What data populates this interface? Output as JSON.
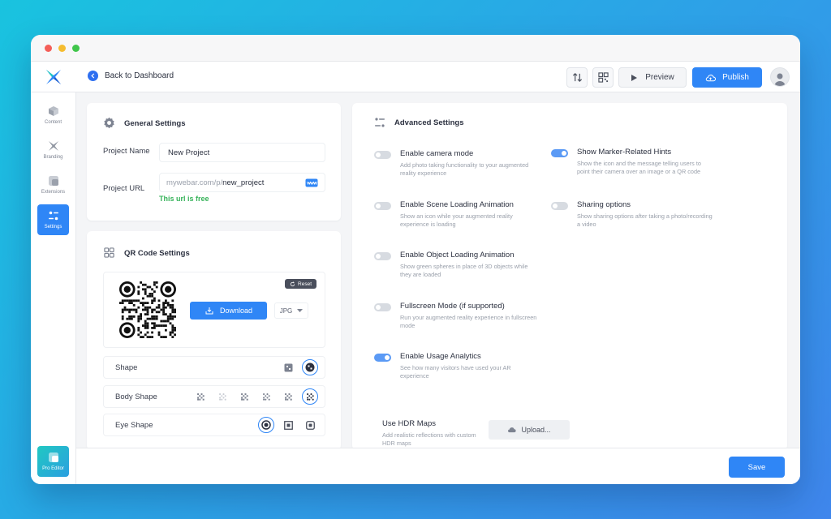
{
  "topbar": {
    "back_label": "Back to Dashboard",
    "preview_label": "Preview",
    "publish_label": "Publish"
  },
  "sidebar": {
    "items": [
      {
        "label": "Content",
        "icon": "cube-icon"
      },
      {
        "label": "Branding",
        "icon": "branding-icon"
      },
      {
        "label": "Extensions",
        "icon": "extensions-icon"
      },
      {
        "label": "Settings",
        "icon": "settings-icon",
        "active": true
      }
    ],
    "pro_editor_label": "Pro Editor"
  },
  "general": {
    "title": "General Settings",
    "project_name_label": "Project Name",
    "project_name_value": "New Project",
    "project_url_label": "Project URL",
    "url_prefix": "mywebar.com/p/",
    "url_slug": "new_project",
    "url_status": "This url is free"
  },
  "qr": {
    "title": "QR Code Settings",
    "reset_label": "Reset",
    "download_label": "Download",
    "format_value": "JPG",
    "shape_label": "Shape",
    "body_shape_label": "Body Shape",
    "eye_shape_label": "Eye Shape"
  },
  "advanced": {
    "title": "Advanced Settings",
    "settings": [
      {
        "title": "Enable camera mode",
        "desc": "Add photo taking functionality to your augmented reality experience",
        "on": false
      },
      {
        "title": "Enable Scene Loading Animation",
        "desc": "Show an icon while your augmented reality experience is loading",
        "on": false
      },
      {
        "title": "Enable Object Loading Animation",
        "desc": "Show green spheres in place of 3D objects while they are loaded",
        "on": false
      },
      {
        "title": "Fullscreen Mode (if supported)",
        "desc": "Run your augmented reality experience in fullscreen mode",
        "on": false
      },
      {
        "title": "Enable Usage Analytics",
        "desc": "See how many visitors have used your AR experience",
        "on": true
      },
      {
        "title": "Show Marker-Related Hints",
        "desc": "Show the icon and the message telling users to point their camera over an image or a QR code",
        "on": true
      },
      {
        "title": "Sharing options",
        "desc": "Show sharing options after taking a photo/recording a video",
        "on": false
      }
    ],
    "hdr_title": "Use HDR Maps",
    "hdr_desc": "Add realistic reflections with custom HDR maps",
    "upload_label": "Upload..."
  },
  "footer": {
    "save_label": "Save"
  },
  "colors": {
    "accent": "#2f86f6",
    "success": "#36b35a",
    "toggle_on": "#5b9af5",
    "toggle_off": "#d7dbe1"
  }
}
